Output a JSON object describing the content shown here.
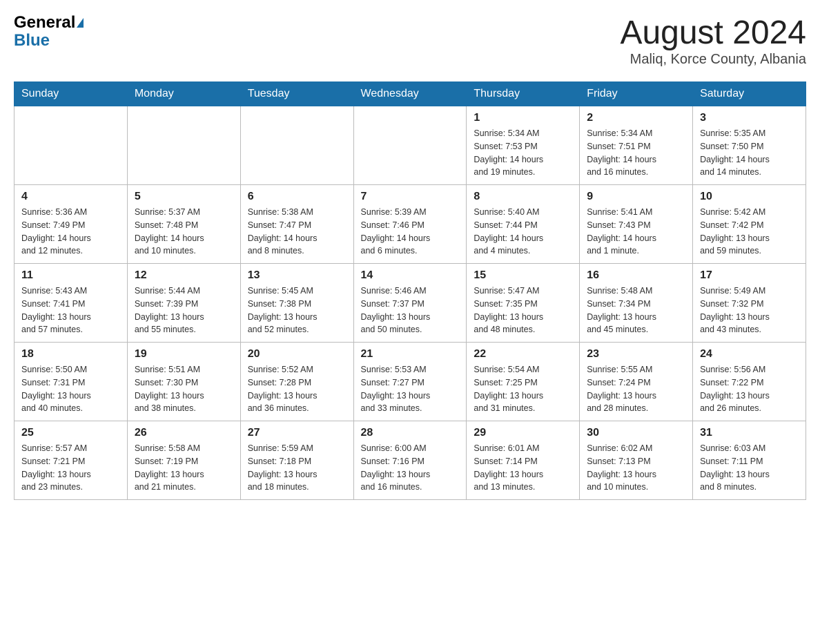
{
  "header": {
    "logo_general": "General",
    "logo_blue": "Blue",
    "month_title": "August 2024",
    "location": "Maliq, Korce County, Albania"
  },
  "days_of_week": [
    "Sunday",
    "Monday",
    "Tuesday",
    "Wednesday",
    "Thursday",
    "Friday",
    "Saturday"
  ],
  "weeks": [
    [
      {
        "day": "",
        "info": ""
      },
      {
        "day": "",
        "info": ""
      },
      {
        "day": "",
        "info": ""
      },
      {
        "day": "",
        "info": ""
      },
      {
        "day": "1",
        "info": "Sunrise: 5:34 AM\nSunset: 7:53 PM\nDaylight: 14 hours\nand 19 minutes."
      },
      {
        "day": "2",
        "info": "Sunrise: 5:34 AM\nSunset: 7:51 PM\nDaylight: 14 hours\nand 16 minutes."
      },
      {
        "day": "3",
        "info": "Sunrise: 5:35 AM\nSunset: 7:50 PM\nDaylight: 14 hours\nand 14 minutes."
      }
    ],
    [
      {
        "day": "4",
        "info": "Sunrise: 5:36 AM\nSunset: 7:49 PM\nDaylight: 14 hours\nand 12 minutes."
      },
      {
        "day": "5",
        "info": "Sunrise: 5:37 AM\nSunset: 7:48 PM\nDaylight: 14 hours\nand 10 minutes."
      },
      {
        "day": "6",
        "info": "Sunrise: 5:38 AM\nSunset: 7:47 PM\nDaylight: 14 hours\nand 8 minutes."
      },
      {
        "day": "7",
        "info": "Sunrise: 5:39 AM\nSunset: 7:46 PM\nDaylight: 14 hours\nand 6 minutes."
      },
      {
        "day": "8",
        "info": "Sunrise: 5:40 AM\nSunset: 7:44 PM\nDaylight: 14 hours\nand 4 minutes."
      },
      {
        "day": "9",
        "info": "Sunrise: 5:41 AM\nSunset: 7:43 PM\nDaylight: 14 hours\nand 1 minute."
      },
      {
        "day": "10",
        "info": "Sunrise: 5:42 AM\nSunset: 7:42 PM\nDaylight: 13 hours\nand 59 minutes."
      }
    ],
    [
      {
        "day": "11",
        "info": "Sunrise: 5:43 AM\nSunset: 7:41 PM\nDaylight: 13 hours\nand 57 minutes."
      },
      {
        "day": "12",
        "info": "Sunrise: 5:44 AM\nSunset: 7:39 PM\nDaylight: 13 hours\nand 55 minutes."
      },
      {
        "day": "13",
        "info": "Sunrise: 5:45 AM\nSunset: 7:38 PM\nDaylight: 13 hours\nand 52 minutes."
      },
      {
        "day": "14",
        "info": "Sunrise: 5:46 AM\nSunset: 7:37 PM\nDaylight: 13 hours\nand 50 minutes."
      },
      {
        "day": "15",
        "info": "Sunrise: 5:47 AM\nSunset: 7:35 PM\nDaylight: 13 hours\nand 48 minutes."
      },
      {
        "day": "16",
        "info": "Sunrise: 5:48 AM\nSunset: 7:34 PM\nDaylight: 13 hours\nand 45 minutes."
      },
      {
        "day": "17",
        "info": "Sunrise: 5:49 AM\nSunset: 7:32 PM\nDaylight: 13 hours\nand 43 minutes."
      }
    ],
    [
      {
        "day": "18",
        "info": "Sunrise: 5:50 AM\nSunset: 7:31 PM\nDaylight: 13 hours\nand 40 minutes."
      },
      {
        "day": "19",
        "info": "Sunrise: 5:51 AM\nSunset: 7:30 PM\nDaylight: 13 hours\nand 38 minutes."
      },
      {
        "day": "20",
        "info": "Sunrise: 5:52 AM\nSunset: 7:28 PM\nDaylight: 13 hours\nand 36 minutes."
      },
      {
        "day": "21",
        "info": "Sunrise: 5:53 AM\nSunset: 7:27 PM\nDaylight: 13 hours\nand 33 minutes."
      },
      {
        "day": "22",
        "info": "Sunrise: 5:54 AM\nSunset: 7:25 PM\nDaylight: 13 hours\nand 31 minutes."
      },
      {
        "day": "23",
        "info": "Sunrise: 5:55 AM\nSunset: 7:24 PM\nDaylight: 13 hours\nand 28 minutes."
      },
      {
        "day": "24",
        "info": "Sunrise: 5:56 AM\nSunset: 7:22 PM\nDaylight: 13 hours\nand 26 minutes."
      }
    ],
    [
      {
        "day": "25",
        "info": "Sunrise: 5:57 AM\nSunset: 7:21 PM\nDaylight: 13 hours\nand 23 minutes."
      },
      {
        "day": "26",
        "info": "Sunrise: 5:58 AM\nSunset: 7:19 PM\nDaylight: 13 hours\nand 21 minutes."
      },
      {
        "day": "27",
        "info": "Sunrise: 5:59 AM\nSunset: 7:18 PM\nDaylight: 13 hours\nand 18 minutes."
      },
      {
        "day": "28",
        "info": "Sunrise: 6:00 AM\nSunset: 7:16 PM\nDaylight: 13 hours\nand 16 minutes."
      },
      {
        "day": "29",
        "info": "Sunrise: 6:01 AM\nSunset: 7:14 PM\nDaylight: 13 hours\nand 13 minutes."
      },
      {
        "day": "30",
        "info": "Sunrise: 6:02 AM\nSunset: 7:13 PM\nDaylight: 13 hours\nand 10 minutes."
      },
      {
        "day": "31",
        "info": "Sunrise: 6:03 AM\nSunset: 7:11 PM\nDaylight: 13 hours\nand 8 minutes."
      }
    ]
  ]
}
